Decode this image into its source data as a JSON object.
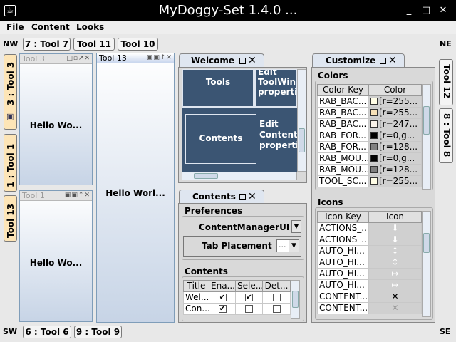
{
  "window": {
    "title": "MyDoggy-Set 1.4.0 ...",
    "app_icon": "☕",
    "controls": [
      "_",
      "□",
      "✕"
    ]
  },
  "menu": [
    "File",
    "Content",
    "Looks"
  ],
  "corners": {
    "nw": "NW",
    "ne": "NE",
    "sw": "SW",
    "se": "SE"
  },
  "top_bar": [
    "7 : Tool 7",
    "Tool 11",
    "Tool 10"
  ],
  "bottom_bar": [
    "6 : Tool 6",
    "9 : Tool 9"
  ],
  "left_bar": [
    "3 : Tool 3",
    "1 : Tool 1",
    "Tool 13"
  ],
  "right_bar": [
    "Tool 12",
    "8 : Tool 8"
  ],
  "tool_windows": {
    "tool3": {
      "name": "Tool 3",
      "content": "Hello Wo..."
    },
    "tool1": {
      "name": "Tool 1",
      "content": "Hello Wo..."
    },
    "tool13": {
      "name": "Tool 13",
      "content": "Hello Worl..."
    }
  },
  "welcome": {
    "tab": "Welcome",
    "rows": [
      {
        "left": "Tools",
        "right": [
          "Edit",
          "ToolWin",
          "properti"
        ]
      },
      {
        "left": "Contents",
        "right": [
          "Edit",
          "Content",
          "properti"
        ]
      }
    ]
  },
  "contents_panel": {
    "tab": "Contents",
    "preferences_title": "Preferences",
    "manager_label": "ContentManagerUI :",
    "placement_label": "Tab Placement :",
    "placement_value": "...",
    "contents_title": "Contents",
    "columns": [
      "Title",
      "Ena...",
      "Sele...",
      "Det..."
    ],
    "rows": [
      {
        "title": "Wel...",
        "enabled": true,
        "selected": true,
        "detached": false
      },
      {
        "title": "Con...",
        "enabled": true,
        "selected": false,
        "detached": false
      }
    ]
  },
  "customize": {
    "tab": "Customize",
    "colors_title": "Colors",
    "color_columns": [
      "Color Key",
      "Color"
    ],
    "color_rows": [
      {
        "key": "RAB_BAC...",
        "swatch": "#fffde6",
        "value": "[r=255..."
      },
      {
        "key": "RAB_BAC...",
        "swatch": "#f7e1b8",
        "value": "[r=255..."
      },
      {
        "key": "RAB_BAC...",
        "swatch": "#f9f3ea",
        "value": "[r=247..."
      },
      {
        "key": "RAB_FOR...",
        "swatch": "#000000",
        "value": "[r=0,g..."
      },
      {
        "key": "RAB_FOR...",
        "swatch": "#808080",
        "value": "[r=128..."
      },
      {
        "key": "RAB_MOU...",
        "swatch": "#000000",
        "value": "[r=0,g..."
      },
      {
        "key": "RAB_MOU...",
        "swatch": "#808080",
        "value": "[r=128..."
      },
      {
        "key": "TOOL_SC...",
        "swatch": "#fffde6",
        "value": "[r=255..."
      }
    ],
    "icons_title": "Icons",
    "icon_columns": [
      "Icon Key",
      "Icon"
    ],
    "icon_rows": [
      {
        "key": "ACTIONS_...",
        "icon": "⬇"
      },
      {
        "key": "ACTIONS_...",
        "icon": "⬇"
      },
      {
        "key": "AUTO_HI...",
        "icon": "↕"
      },
      {
        "key": "AUTO_HI...",
        "icon": "↕"
      },
      {
        "key": "AUTO_HI...",
        "icon": "↦"
      },
      {
        "key": "AUTO_HI...",
        "icon": "↦"
      },
      {
        "key": "CONTENT...",
        "icon": "✕"
      },
      {
        "key": "CONTENT...",
        "icon": "✕"
      }
    ]
  },
  "colors": {
    "accent": "#3b5573",
    "active_tool_button": "#fde5b7",
    "tool_gradient_bottom": "#c7d4e6"
  }
}
